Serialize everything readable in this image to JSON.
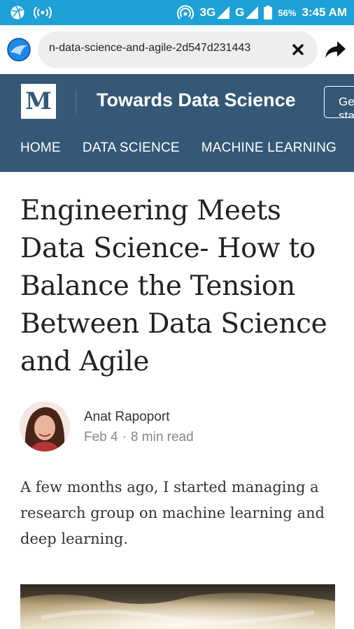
{
  "status_bar": {
    "net_1": "3G",
    "net_2": "G",
    "battery": "56%",
    "time": "3:45 AM",
    "icons": [
      "dribbble-icon",
      "wifi-tethering-icon",
      "hotspot-icon",
      "signal-icon",
      "battery-icon"
    ]
  },
  "browser": {
    "url": "n-data-science-and-agile-2d547d231443",
    "icons": [
      "browser-logo-icon",
      "close-icon",
      "share-icon"
    ]
  },
  "site": {
    "logo_letter": "M",
    "title": "Towards Data Science",
    "cta": "Get started",
    "nav": [
      "HOME",
      "DATA SCIENCE",
      "MACHINE LEARNING"
    ]
  },
  "article": {
    "headline": "Engineering Meets Data Science- How to Balance the Tension Between Data Science and Agile",
    "author": "Anat Rapoport",
    "date": "Feb 4",
    "read_time": "8 min read",
    "intro": "A few months ago, I started managing a research group on machine learning and deep learning."
  },
  "colors": {
    "status_bar": "#1da1d6",
    "header": "#355876",
    "text": "#222222",
    "meta": "#888888"
  }
}
